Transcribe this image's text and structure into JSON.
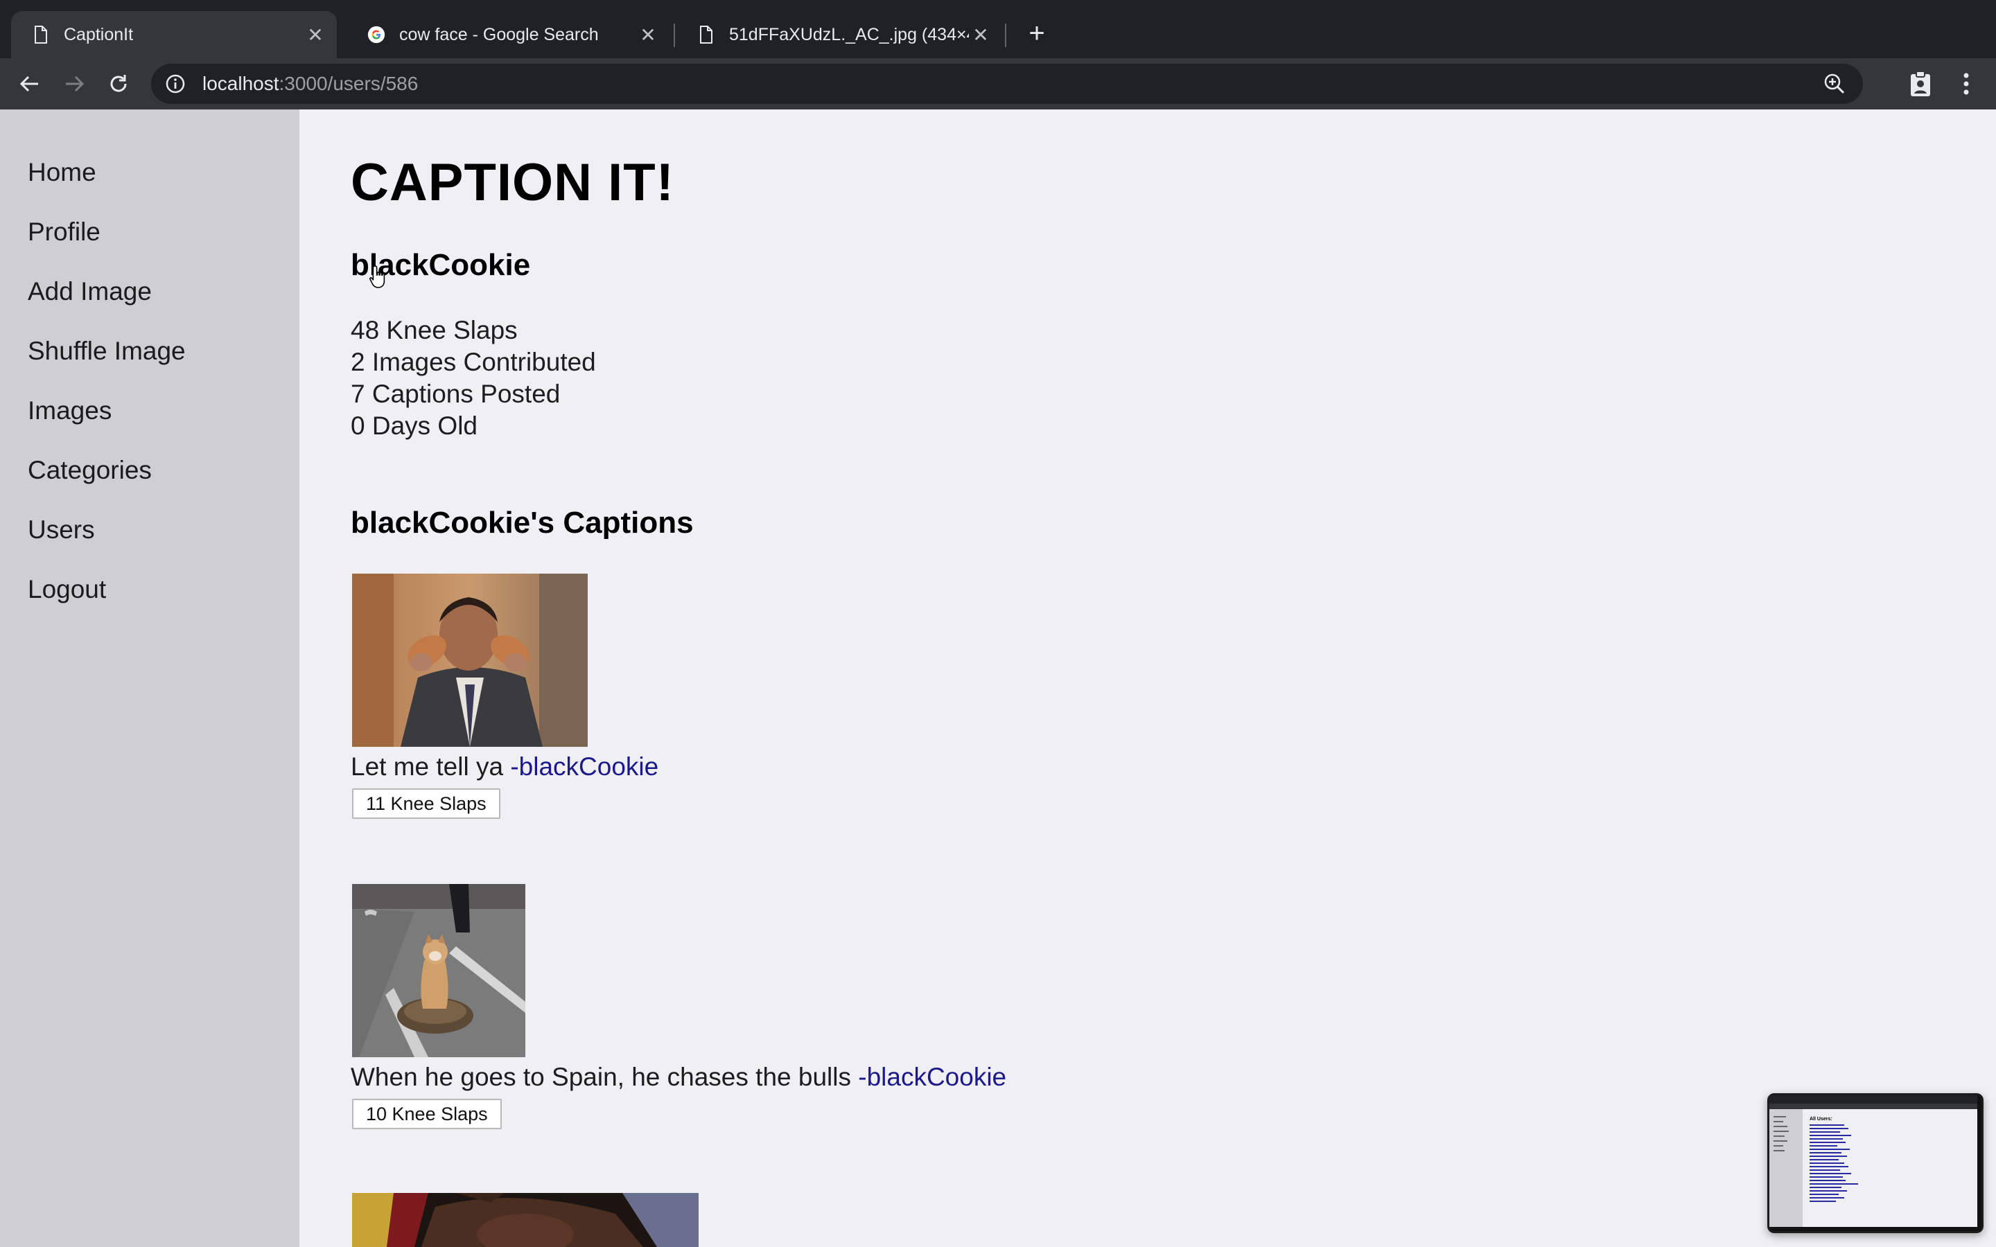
{
  "browser": {
    "tabs": [
      {
        "title": "CaptionIt",
        "icon": "page-icon",
        "active": true
      },
      {
        "title": "cow face - Google Search",
        "icon": "google-icon",
        "active": false
      },
      {
        "title": "51dFFaXUdzL._AC_.jpg (434×4",
        "icon": "page-icon",
        "active": false
      }
    ],
    "url_host": "localhost",
    "url_path": ":3000/users/586"
  },
  "sidebar": {
    "items": [
      "Home",
      "Profile",
      "Add Image",
      "Shuffle Image",
      "Images",
      "Categories",
      "Users",
      "Logout"
    ]
  },
  "page": {
    "site_title": "CAPTION IT!",
    "username": "blackCookie",
    "stats": [
      "48 Knee Slaps",
      "2 Images Contributed",
      "7 Captions Posted",
      "0 Days Old"
    ],
    "captions_heading": "blackCookie's Captions",
    "captions": [
      {
        "text": "Let me tell ya ",
        "author": "-blackCookie",
        "button": "11 Knee Slaps"
      },
      {
        "text": "When he goes to Spain, he chases the bulls ",
        "author": "-blackCookie",
        "button": "10 Knee Slaps"
      }
    ],
    "preview_heading": "All Users:"
  },
  "colors": {
    "tabstrip": "#202124",
    "toolbar": "#35363a",
    "sidebar_bg": "#cfced3",
    "page_bg": "#f0eff3",
    "link": "#1c1a8a"
  }
}
